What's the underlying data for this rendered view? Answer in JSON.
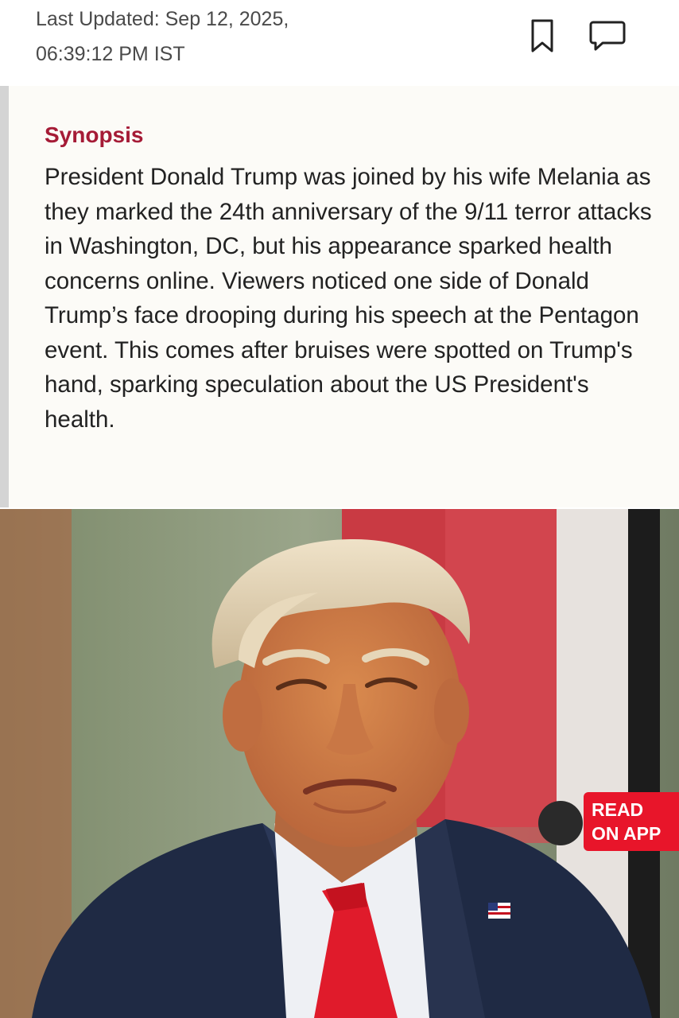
{
  "header": {
    "last_updated_line1": "Last Updated: Sep 12, 2025,",
    "last_updated_line2": "06:39:12 PM IST",
    "icons": [
      "bookmark-icon",
      "comment-icon"
    ]
  },
  "synopsis": {
    "title": "Synopsis",
    "text": "President Donald Trump was joined by his wife Melania as they marked the 24th anniversary of the 9/11 terror attacks in Washington, DC, but his appearance sparked health concerns online. Viewers noticed one side of Donald Trump’s face drooping during his speech at the Pentagon event. This comes after bruises were spotted on Trump's hand, sparking speculation about the US President's health."
  },
  "read_on_app": {
    "line1": "READ",
    "line2": "ON APP"
  },
  "colors": {
    "synopsis_title": "#a51b36",
    "synopsis_background": "#fcfbf7",
    "read_on_app_badge": "#e8152a"
  }
}
